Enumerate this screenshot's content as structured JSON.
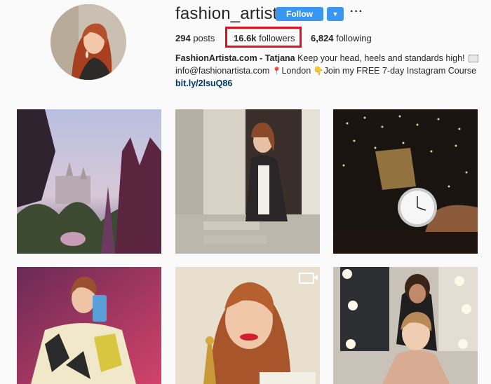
{
  "profile": {
    "username": "fashion_artista",
    "follow_label": "Follow",
    "dropdown_icon": "chevron-down-icon",
    "more_icon": "more-horizontal-icon"
  },
  "stats": {
    "posts_count": "294",
    "posts_label": "posts",
    "followers_count": "16.6k",
    "followers_label": "followers",
    "following_count": "6,824",
    "following_label": "following"
  },
  "bio": {
    "name": "FashionArtista.com - Tatjana",
    "tagline": "Keep your head, heels and standards high!",
    "email": "info@fashionartista.com",
    "location": "London",
    "cta": "Join my FREE 7-day Instagram Course",
    "link": "bit.ly/2lsuQ86"
  },
  "colors": {
    "follow_button": "#3897f0",
    "highlight": "#e0101c",
    "link": "#003569"
  },
  "posts": [
    {
      "type": "photo",
      "subject": "flowers-castle"
    },
    {
      "type": "photo",
      "subject": "woman-doorway"
    },
    {
      "type": "photo",
      "subject": "watch-lights"
    },
    {
      "type": "photo",
      "subject": "selfie-phone"
    },
    {
      "type": "video",
      "subject": "woman-award",
      "icon": "video-camera-icon"
    },
    {
      "type": "photo",
      "subject": "hair-salon"
    }
  ]
}
